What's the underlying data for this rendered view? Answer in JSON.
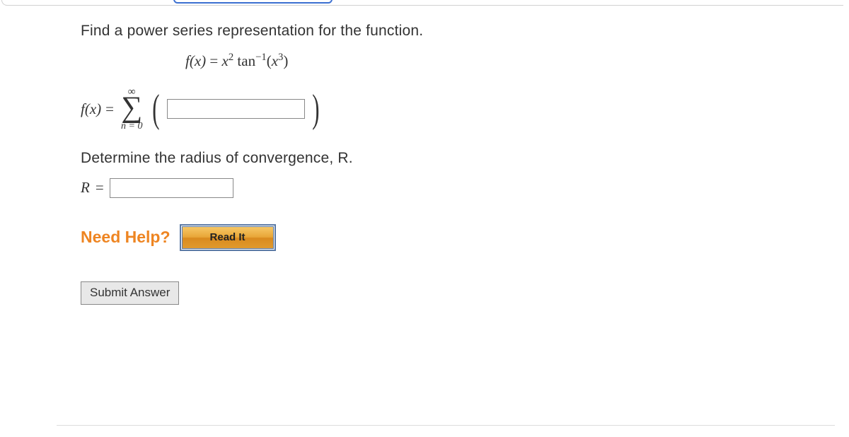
{
  "question": {
    "prompt": "Find a power series representation for the function.",
    "function_lhs": "f(x)",
    "function_eq": "=",
    "function_rhs_x2": "x",
    "function_rhs_x2_exp": "2",
    "function_rhs_tan": " tan",
    "function_rhs_tan_exp": "−1",
    "function_rhs_open": "(",
    "function_rhs_x3": "x",
    "function_rhs_x3_exp": "3",
    "function_rhs_close": ")",
    "series_lhs": "f(x)",
    "series_eq": "=",
    "sigma_top": "∞",
    "sigma_bottom": "n = 0",
    "paren_open": "(",
    "paren_close": ")",
    "series_input_value": "",
    "radius_prompt": "Determine the radius of convergence, R.",
    "radius_lhs": "R",
    "radius_eq": "=",
    "radius_input_value": ""
  },
  "help": {
    "label": "Need Help?",
    "read_it": "Read It"
  },
  "submit": {
    "label": "Submit Answer"
  }
}
